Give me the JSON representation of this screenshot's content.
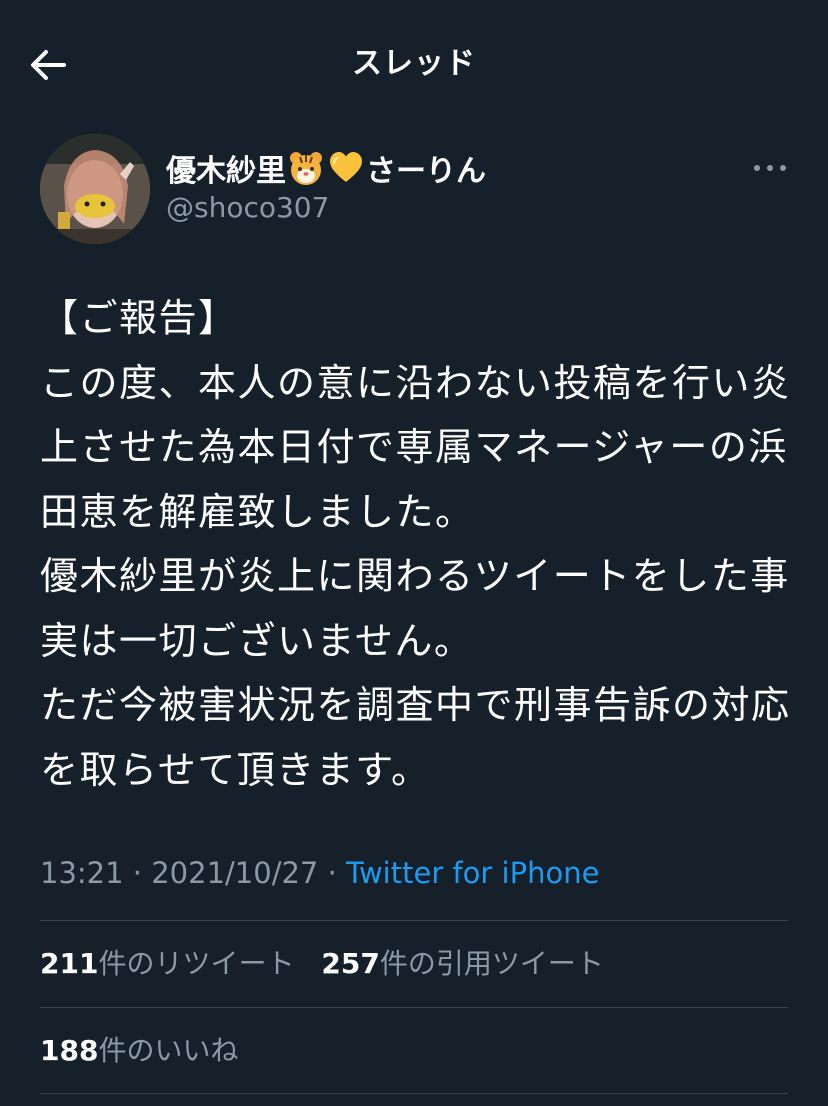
{
  "header": {
    "title": "スレッド",
    "back_icon": "arrow-left-icon"
  },
  "tweet": {
    "author": {
      "name_prefix": "優木紗里",
      "emoji_1": "tiger-face-icon",
      "emoji_2": "yellow-heart-icon",
      "name_suffix": "さーりん",
      "handle": "@shoco307"
    },
    "text": "【ご報告】\nこの度、本人の意に沿わない投稿を行い炎上させた為本日付で専属マネージャーの浜田恵を解雇致しました。\n優木紗里が炎上に関わるツイートをした事実は一切ございません。\nただ今被害状況を調査中で刑事告訴の対応を取らせて頂きます。",
    "time": "13:21",
    "sep1": " · ",
    "date": "2021/10/27",
    "sep2": " · ",
    "source": "Twitter for iPhone"
  },
  "stats": {
    "retweets_count": "211",
    "retweets_label": "件のリツイート",
    "quotes_count": "257",
    "quotes_label": "件の引用ツイート",
    "likes_count": "188",
    "likes_label": "件のいいね"
  },
  "colors": {
    "background": "#15202b",
    "secondary_text": "#8b98a5",
    "link": "#1d9bf0",
    "divider": "#38444d"
  }
}
